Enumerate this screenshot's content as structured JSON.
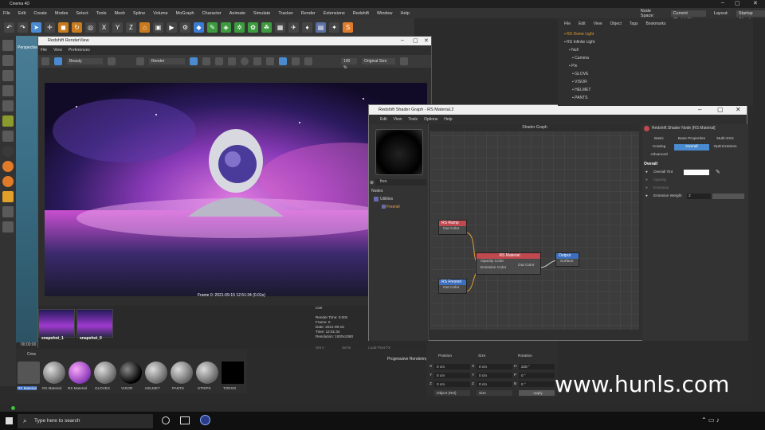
{
  "app": {
    "title": "Cinema 4D"
  },
  "menubar": [
    "File",
    "Edit",
    "Create",
    "Modes",
    "Select",
    "Tools",
    "Mesh",
    "Spline",
    "Volume",
    "MoGraph",
    "Character",
    "Animate",
    "Simulate",
    "Tracker",
    "Render",
    "Extensions",
    "Redshift",
    "Window",
    "Help"
  ],
  "top_right": {
    "node_space_label": "Node Space:",
    "node_space_value": "Current (Redshift)",
    "layout_label": "Layout:",
    "layout_value": "Startup (User)"
  },
  "viewport": {
    "tab": "Perspective"
  },
  "renderview": {
    "title": "Redshift RenderView",
    "menu": [
      "File",
      "View",
      "Preferences"
    ],
    "beauty": "Beauty",
    "render_mode": "Render",
    "zoom": "100 %",
    "color_mode": "Original Size",
    "frame_caption": "Frame  0:  2021-09-15  12:51:34  (0.01s)",
    "snapshots": [
      "snapshot_1",
      "snapshot_0"
    ],
    "info_title": "Live",
    "info_lines": [
      "Render Time: 0.00s",
      "Frame: 0",
      "Date: 2021-09-15",
      "Time: 12:51:34",
      "Resolution: 1920x1080"
    ],
    "bottom_buttons": [
      "Set A",
      "Set B",
      "Load Post FX"
    ],
    "progressive": "Progressive Rendering..."
  },
  "shader_graph": {
    "title": "Redshift Shader Graph - RS Material.2",
    "menu": [
      "Edit",
      "View",
      "Tools",
      "Options",
      "Help"
    ],
    "search_value": "fres",
    "nodes_header": "Nodes",
    "tree_group": "Utilities",
    "tree_item": "Fresnel",
    "graph_header": "Shader Graph",
    "node_ramp": {
      "title": "RS Ramp",
      "port": "Out Color"
    },
    "node_fresnel": {
      "title": "RS Fresnel",
      "port": "Out Color"
    },
    "node_material": {
      "title": "RS Material",
      "in1": "Opacity Color",
      "in2": "Emission Color",
      "out": "Out Color"
    },
    "node_output": {
      "title": "Output",
      "port": "Surface"
    },
    "props_header": "Redshift Shader Node [RS Material]",
    "tabs": [
      "Basic",
      "Base Properties",
      "Multi-SSS",
      "Coating",
      "Overall",
      "Optimizations",
      "Advanced"
    ],
    "section": "Overall",
    "rows": [
      {
        "label": "Overall Tint",
        "value": ""
      },
      {
        "label": "Opacity",
        "value": ""
      },
      {
        "label": "Emission",
        "value": ""
      },
      {
        "label": "Emission Weight",
        "value": "2"
      }
    ]
  },
  "object_manager": {
    "menu": [
      "File",
      "Edit",
      "View",
      "Object",
      "Tags",
      "Bookmarks"
    ],
    "objects": [
      "RS Dome Light",
      "RS Infinite Light",
      "Null",
      "Camera",
      "Pin",
      "GLOVE",
      "VISOR",
      "HELMET",
      "PANTS"
    ]
  },
  "materials": {
    "header": "Crea",
    "items": [
      "RS Material",
      "RS Material",
      "RS Material",
      "GLOVES",
      "VISOR",
      "HELMET",
      "PANTS",
      "STRIPS",
      "TORSO"
    ]
  },
  "coordinates": {
    "headers": [
      "Position",
      "Size",
      "Rotation"
    ],
    "rows": [
      {
        "axis": "X",
        "pos": "0 cm",
        "size": "0 cm",
        "rot_axis": "H",
        "rot": "228 °"
      },
      {
        "axis": "Y",
        "pos": "0 cm",
        "size": "0 cm",
        "rot_axis": "P",
        "rot": "0 °"
      },
      {
        "axis": "Z",
        "pos": "0 cm",
        "size": "0 cm",
        "rot_axis": "B",
        "rot": "0 °"
      }
    ],
    "mode": "Object (Rel)",
    "size_mode": "Size",
    "apply": "Apply"
  },
  "timeline": {
    "time": "00:00:00"
  },
  "watermark": "www.hunls.com",
  "taskbar": {
    "search_placeholder": "Type here to search"
  },
  "colors": {
    "accent": "#4a8ad0",
    "node_header": "#c0484f",
    "output_header": "#3c6fbf"
  }
}
